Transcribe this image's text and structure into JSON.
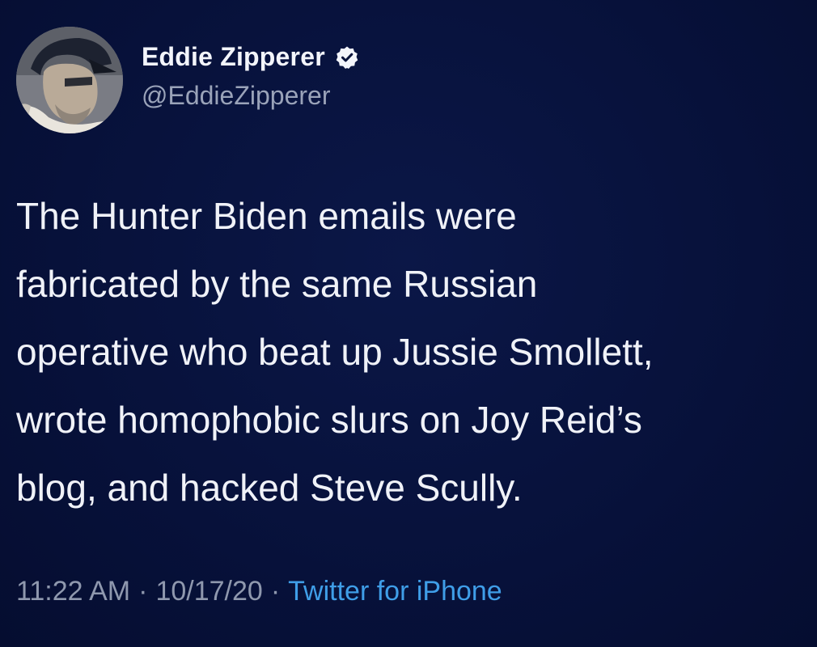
{
  "user": {
    "display_name": "Eddie Zipperer",
    "handle": "@EddieZipperer",
    "verified": true
  },
  "tweet": {
    "lines": [
      "The Hunter Biden emails were",
      "fabricated by the same Russian",
      "operative who beat up Jussie Smollett,",
      "wrote homophobic slurs on Joy Reid’s",
      "blog, and hacked Steve Scully."
    ]
  },
  "meta": {
    "time": "11:22 AM",
    "separator": "·",
    "date": "10/17/20",
    "source": "Twitter for iPhone"
  },
  "colors": {
    "background": "#07123a",
    "text": "#f0f2f8",
    "muted": "#8f98ae",
    "link": "#3f9ee8"
  },
  "icons": {
    "verified": "verified-badge-icon"
  }
}
